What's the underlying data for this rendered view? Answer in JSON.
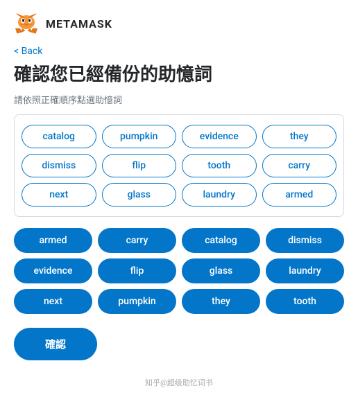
{
  "app": {
    "logo_text": "METAMASK"
  },
  "nav": {
    "back_label": "< Back"
  },
  "page": {
    "title": "確認您已經備份的助憶詞",
    "subtitle": "請依照正確順序點選助憶詞"
  },
  "word_pool": {
    "words": [
      "catalog",
      "pumpkin",
      "evidence",
      "they",
      "dismiss",
      "flip",
      "tooth",
      "carry",
      "next",
      "glass",
      "laundry",
      "armed"
    ]
  },
  "selected_words": [
    "armed",
    "carry",
    "catalog",
    "dismiss",
    "evidence",
    "flip",
    "glass",
    "laundry",
    "next",
    "pumpkin",
    "they",
    "tooth"
  ],
  "confirm_button": {
    "label": "確認"
  },
  "watermark": {
    "text": "知乎@超级助忆词书"
  }
}
